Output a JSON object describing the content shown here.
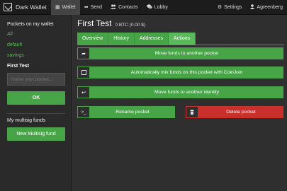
{
  "nav": {
    "brand": "Dark Wallet",
    "items": [
      {
        "label": "Wallet",
        "icon": "wallet-icon",
        "glyph": "▦"
      },
      {
        "label": "Send",
        "icon": "send-icon",
        "glyph": "➦"
      },
      {
        "label": "Contacts",
        "icon": "contacts-icon",
        "glyph": "👥"
      },
      {
        "label": "Lobby",
        "icon": "lobby-icon",
        "glyph": "💬"
      }
    ],
    "settings": "Settings",
    "user": "Agreenberg"
  },
  "sidebar": {
    "title": "Pockets on my wallet",
    "pockets": [
      "All",
      "default",
      "savings"
    ],
    "current": "First Test",
    "name_placeholder": "Name your pocket...",
    "ok_label": "OK",
    "multisig_title": "My multisig funds",
    "multisig_button": "New Multisig fund"
  },
  "main": {
    "title": "First Test",
    "balance": "0 BTC (0.00 $)",
    "tabs": [
      "Overview",
      "History",
      "Addresses",
      "Actions"
    ],
    "active_tab": "Actions",
    "actions": {
      "move_to_pocket": "Move funds to another pocket",
      "coinjoin": "Automatically mix funds on this pocket with CoinJoin",
      "move_to_identity": "Move funds to another identity",
      "rename": "Rename pocket",
      "delete": "Delete pocket"
    }
  },
  "colors": {
    "accent": "#47a447",
    "danger": "#c9302c",
    "background": "#2f2f2f"
  }
}
